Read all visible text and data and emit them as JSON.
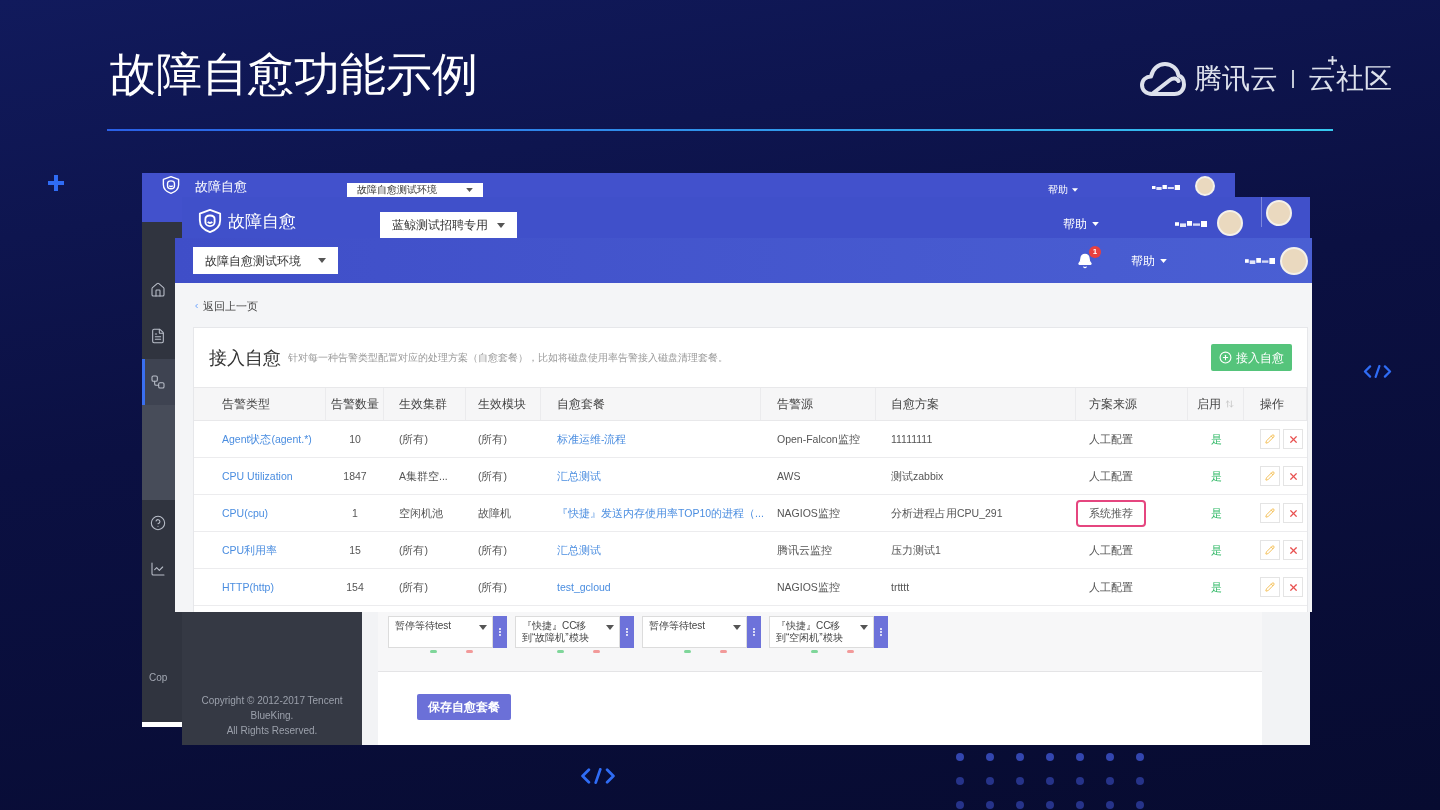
{
  "slide": {
    "title": "故障自愈功能示例",
    "logo": {
      "brand": "腾讯云",
      "community": "云社区"
    }
  },
  "back_window": {
    "header": {
      "app_name": "故障自愈",
      "business_select": "故障自愈测试环境",
      "help": "帮助"
    },
    "sidebar": {
      "items": [
        {
          "selected": false,
          "expanded": false
        },
        {
          "selected": false,
          "expanded": false
        },
        {
          "selected": true,
          "expanded": true
        },
        {
          "selected": false,
          "expanded": false
        },
        {
          "selected": false,
          "expanded": false
        }
      ],
      "copyright": "Cop"
    }
  },
  "middle_window": {
    "header": {
      "app_name": "故障自愈",
      "business_select": "蓝鲸测试招聘专用",
      "help": "帮助"
    },
    "steps": [
      {
        "lines": [
          "暂停等待test"
        ]
      },
      {
        "lines": [
          "『快捷』CC移",
          "到“故障机”模块"
        ]
      },
      {
        "lines": [
          "暂停等待test"
        ]
      },
      {
        "lines": [
          "『快捷』CC移",
          "到“空闲机”模块"
        ]
      }
    ],
    "save_button": "保存自愈套餐",
    "copyright": [
      "Copyright © 2012-2017 Tencent",
      "BlueKing.",
      "All Rights Reserved."
    ]
  },
  "front_window": {
    "header": {
      "business_select": "故障自愈测试环境",
      "notification_count": "1",
      "help": "帮助"
    },
    "back_link": "返回上一页",
    "card": {
      "title": "接入自愈",
      "description": "针对每一种告警类型配置对应的处理方案（自愈套餐），比如将磁盘使用率告警接入磁盘清理套餐。",
      "add_button": "接入自愈"
    },
    "table": {
      "columns": [
        {
          "label": "告警类型",
          "sortable": false
        },
        {
          "label": "告警数量",
          "sortable": false
        },
        {
          "label": "生效集群",
          "sortable": false
        },
        {
          "label": "生效模块",
          "sortable": false
        },
        {
          "label": "自愈套餐",
          "sortable": false
        },
        {
          "label": "告警源",
          "sortable": false
        },
        {
          "label": "自愈方案",
          "sortable": false
        },
        {
          "label": "方案来源",
          "sortable": false
        },
        {
          "label": "启用",
          "sortable": true
        },
        {
          "label": "操作",
          "sortable": false
        }
      ],
      "rows": [
        {
          "alert_type": "Agent状态(agent.*)",
          "count": "10",
          "cluster": "(所有)",
          "module": "(所有)",
          "package": "标准运维-流程",
          "source": "Open-Falcon监控",
          "plan": "11111111",
          "plan_origin": "人工配置",
          "plan_origin_highlighted": false,
          "enabled": "是"
        },
        {
          "alert_type": "CPU Utilization",
          "count": "1847",
          "cluster": "A集群空...",
          "module": "(所有)",
          "package": "汇总测试",
          "source": "AWS",
          "plan": "测试zabbix",
          "plan_origin": "人工配置",
          "plan_origin_highlighted": false,
          "enabled": "是"
        },
        {
          "alert_type": "CPU(cpu)",
          "count": "1",
          "cluster": "空闲机池",
          "module": "故障机",
          "package": "『快捷』发送内存使用率TOP10的进程（...",
          "source": "NAGIOS监控",
          "plan": "分析进程占用CPU_291",
          "plan_origin": "系统推荐",
          "plan_origin_highlighted": true,
          "enabled": "是"
        },
        {
          "alert_type": "CPU利用率",
          "count": "15",
          "cluster": "(所有)",
          "module": "(所有)",
          "package": "汇总测试",
          "source": "腾讯云监控",
          "plan": "压力测试1",
          "plan_origin": "人工配置",
          "plan_origin_highlighted": false,
          "enabled": "是"
        },
        {
          "alert_type": "HTTP(http)",
          "count": "154",
          "cluster": "(所有)",
          "module": "(所有)",
          "package": "test_gcloud",
          "source": "NAGIOS监控",
          "plan": "trtttt",
          "plan_origin": "人工配置",
          "plan_origin_highlighted": false,
          "enabled": "是"
        }
      ]
    }
  }
}
